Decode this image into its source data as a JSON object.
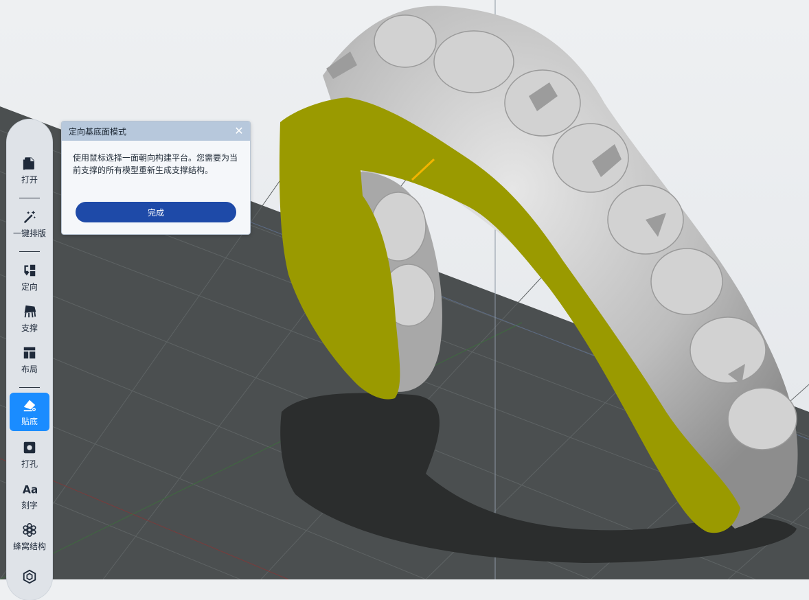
{
  "toolbar": {
    "items": [
      {
        "label": "打开",
        "icon": "file-icon"
      },
      {
        "label": "一键排版",
        "icon": "magic-wand-icon"
      },
      {
        "label": "定向",
        "icon": "orient-icon"
      },
      {
        "label": "支撑",
        "icon": "support-icon"
      },
      {
        "label": "布局",
        "icon": "layout-icon"
      },
      {
        "label": "贴底",
        "icon": "eraser-icon",
        "active": true
      },
      {
        "label": "打孔",
        "icon": "hole-icon"
      },
      {
        "label": "刻字",
        "icon": "text-icon"
      },
      {
        "label": "蜂窝结构",
        "icon": "honeycomb-icon"
      },
      {
        "label": "",
        "icon": "cube-icon"
      }
    ]
  },
  "dialog": {
    "title": "定向基底面模式",
    "message": "使用鼠标选择一面朝向构建平台。您需要为当前支撑的所有模型重新生成支撑结构。",
    "done_label": "完成",
    "close_icon": "close-icon"
  },
  "colors": {
    "accent": "#1a8cff",
    "button": "#1e4aa8",
    "selection_face": "#9a9a00",
    "model": "#b4b4b4",
    "platform": "#4a4e4f"
  }
}
